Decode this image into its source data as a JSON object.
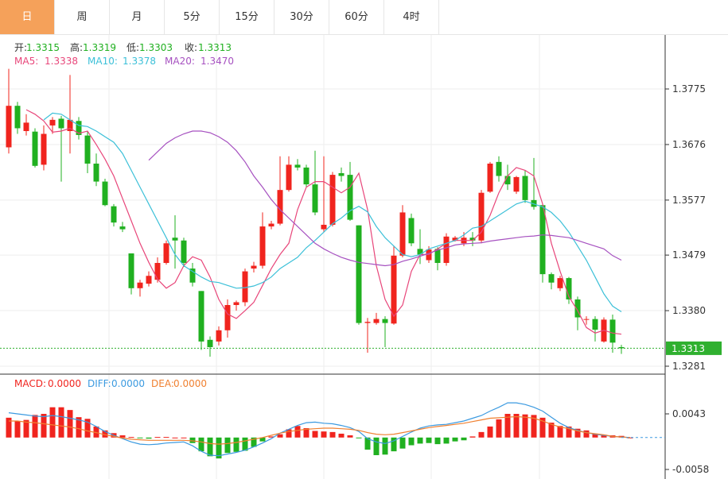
{
  "tabs": [
    {
      "label": "日",
      "active": true
    },
    {
      "label": "周",
      "active": false
    },
    {
      "label": "月",
      "active": false
    },
    {
      "label": "5分",
      "active": false
    },
    {
      "label": "15分",
      "active": false
    },
    {
      "label": "30分",
      "active": false
    },
    {
      "label": "60分",
      "active": false
    },
    {
      "label": "4时",
      "active": false
    }
  ],
  "ohlc_info": {
    "open_label": "开:",
    "open": "1.3315",
    "high_label": "高:",
    "high": "1.3319",
    "low_label": "低:",
    "low": "1.3303",
    "close_label": "收:",
    "close": "1.3313"
  },
  "ma_info": {
    "ma5_label": "MA5:",
    "ma5": "1.3338",
    "ma10_label": "MA10:",
    "ma10": "1.3378",
    "ma20_label": "MA20:",
    "ma20": "1.3470"
  },
  "macd_info": {
    "macd_label": "MACD:",
    "macd": "0.0000",
    "diff_label": "DIFF:",
    "diff": "0.0000",
    "dea_label": "DEA:",
    "dea": "0.0000"
  },
  "colors": {
    "up": "#f0241e",
    "down": "#20b020",
    "ma5": "#e8467a",
    "ma10": "#3cc0d8",
    "ma20": "#a651c0",
    "diff": "#3b9ae0",
    "dea": "#f08030",
    "current": "#2fb02f"
  },
  "chart_data": [
    {
      "type": "candlestick",
      "title": "",
      "y_ticks": [
        1.3775,
        1.3676,
        1.3577,
        1.3479,
        1.338,
        1.3281
      ],
      "y_tick_labels": [
        "1.3775",
        "1.3676",
        "1.3577",
        "1.3479",
        "1.3380",
        "1.3281"
      ],
      "ylim": [
        1.326,
        1.383
      ],
      "current_price": "1.3313",
      "candles": [
        [
          1.3671,
          1.3745,
          1.366,
          1.3811
        ],
        [
          1.3745,
          1.3705,
          1.3695,
          1.3752
        ],
        [
          1.37,
          1.3715,
          1.3692,
          1.373
        ],
        [
          1.3699,
          1.3638,
          1.3635,
          1.3705
        ],
        [
          1.364,
          1.3695,
          1.363,
          1.371
        ],
        [
          1.371,
          1.372,
          1.3695,
          1.3725
        ],
        [
          1.3722,
          1.3705,
          1.361,
          1.3727
        ],
        [
          1.37,
          1.372,
          1.366,
          1.38
        ],
        [
          1.3718,
          1.3693,
          1.3685,
          1.3725
        ],
        [
          1.3692,
          1.3642,
          1.3625,
          1.37
        ],
        [
          1.3642,
          1.361,
          1.3602,
          1.366
        ],
        [
          1.361,
          1.3568,
          1.3566,
          1.3615
        ],
        [
          1.3566,
          1.3537,
          1.353,
          1.357
        ],
        [
          1.353,
          1.3525,
          1.352,
          1.3538
        ],
        [
          1.3482,
          1.342,
          1.3409,
          1.3482
        ],
        [
          1.342,
          1.343,
          1.3405,
          1.3435
        ],
        [
          1.3428,
          1.3442,
          1.3423,
          1.345
        ],
        [
          1.3435,
          1.3465,
          1.343,
          1.3475
        ],
        [
          1.3465,
          1.35,
          1.3462,
          1.3505
        ],
        [
          1.351,
          1.3505,
          1.3455,
          1.355
        ],
        [
          1.3505,
          1.3465,
          1.3458,
          1.351
        ],
        [
          1.3455,
          1.343,
          1.3423,
          1.3465
        ],
        [
          1.3415,
          1.3325,
          1.331,
          1.3415
        ],
        [
          1.3328,
          1.3315,
          1.3298,
          1.3334
        ],
        [
          1.3325,
          1.3345,
          1.3318,
          1.3352
        ],
        [
          1.3345,
          1.339,
          1.3332,
          1.34
        ],
        [
          1.339,
          1.3395,
          1.338,
          1.3398
        ],
        [
          1.3395,
          1.345,
          1.3388,
          1.3455
        ],
        [
          1.3455,
          1.346,
          1.3448,
          1.3467
        ],
        [
          1.346,
          1.353,
          1.3455,
          1.3555
        ],
        [
          1.353,
          1.3535,
          1.3525,
          1.354
        ],
        [
          1.3535,
          1.3595,
          1.3532,
          1.3655
        ],
        [
          1.3595,
          1.364,
          1.3592,
          1.3655
        ],
        [
          1.364,
          1.3635,
          1.363,
          1.365
        ],
        [
          1.3635,
          1.3605,
          1.36,
          1.364
        ],
        [
          1.3605,
          1.3555,
          1.355,
          1.3665
        ],
        [
          1.3525,
          1.3533,
          1.352,
          1.3655
        ],
        [
          1.3533,
          1.3622,
          1.353,
          1.3627
        ],
        [
          1.3625,
          1.362,
          1.361,
          1.3635
        ],
        [
          1.3622,
          1.3542,
          1.354,
          1.3645
        ],
        [
          1.3532,
          1.3358,
          1.3355,
          1.3532
        ],
        [
          1.3358,
          1.336,
          1.3305,
          1.3367
        ],
        [
          1.3358,
          1.3365,
          1.3355,
          1.3376
        ],
        [
          1.3365,
          1.3358,
          1.3315,
          1.337
        ],
        [
          1.3357,
          1.3478,
          1.3355,
          1.3495
        ],
        [
          1.3478,
          1.3555,
          1.3475,
          1.3568
        ],
        [
          1.3545,
          1.35,
          1.3495,
          1.3553
        ],
        [
          1.349,
          1.348,
          1.3463,
          1.3525
        ],
        [
          1.347,
          1.3489,
          1.3465,
          1.3495
        ],
        [
          1.349,
          1.3465,
          1.3452,
          1.3493
        ],
        [
          1.3465,
          1.3512,
          1.346,
          1.3518
        ],
        [
          1.3505,
          1.351,
          1.3503,
          1.3513
        ],
        [
          1.35,
          1.351,
          1.3495,
          1.352
        ],
        [
          1.351,
          1.3505,
          1.3495,
          1.352
        ],
        [
          1.3505,
          1.359,
          1.35,
          1.3595
        ],
        [
          1.3592,
          1.3642,
          1.359,
          1.3645
        ],
        [
          1.3645,
          1.362,
          1.361,
          1.3655
        ],
        [
          1.362,
          1.3605,
          1.3595,
          1.364
        ],
        [
          1.3592,
          1.3618,
          1.3588,
          1.362
        ],
        [
          1.362,
          1.3577,
          1.3572,
          1.363
        ],
        [
          1.3577,
          1.3565,
          1.356,
          1.3652
        ],
        [
          1.3568,
          1.3445,
          1.343,
          1.357
        ],
        [
          1.3445,
          1.343,
          1.3418,
          1.3448
        ],
        [
          1.342,
          1.3438,
          1.3415,
          1.3442
        ],
        [
          1.3438,
          1.34,
          1.3392,
          1.344
        ],
        [
          1.34,
          1.3368,
          1.3345,
          1.3405
        ],
        [
          1.3365,
          1.3365,
          1.3355,
          1.337
        ],
        [
          1.3365,
          1.3346,
          1.3325,
          1.337
        ],
        [
          1.3325,
          1.3364,
          1.3323,
          1.3368
        ],
        [
          1.3364,
          1.3323,
          1.3305,
          1.3373
        ],
        [
          1.3315,
          1.3313,
          1.3303,
          1.3319
        ]
      ],
      "ma5": [
        1.3738,
        1.373,
        1.3718,
        1.3698,
        1.37,
        1.3705,
        1.3696,
        1.37,
        1.3676,
        1.365,
        1.362,
        1.358,
        1.354,
        1.35,
        1.3466,
        1.3436,
        1.342,
        1.343,
        1.346,
        1.3476,
        1.347,
        1.344,
        1.34,
        1.3374,
        1.3366,
        1.338,
        1.3395,
        1.3425,
        1.3455,
        1.348,
        1.35,
        1.356,
        1.36,
        1.361,
        1.361,
        1.36,
        1.359,
        1.36,
        1.3625,
        1.356,
        1.346,
        1.34,
        1.337,
        1.339,
        1.345,
        1.348,
        1.348,
        1.349,
        1.35,
        1.3505,
        1.3505,
        1.3505,
        1.352,
        1.355,
        1.359,
        1.362,
        1.3635,
        1.363,
        1.362,
        1.357,
        1.35,
        1.345,
        1.3405,
        1.338,
        1.335,
        1.334,
        1.3345,
        1.334,
        1.3338
      ],
      "ma10": [
        1.372,
        1.3732,
        1.373,
        1.372,
        1.371,
        1.3708,
        1.37,
        1.369,
        1.368,
        1.366,
        1.363,
        1.36,
        1.357,
        1.354,
        1.351,
        1.348,
        1.346,
        1.345,
        1.344,
        1.3432,
        1.343,
        1.3425,
        1.342,
        1.3421,
        1.3424,
        1.343,
        1.344,
        1.3455,
        1.3465,
        1.3475,
        1.3492,
        1.3505,
        1.352,
        1.3535,
        1.3545,
        1.3558,
        1.3566,
        1.3556,
        1.353,
        1.351,
        1.3495,
        1.348,
        1.3476,
        1.348,
        1.349,
        1.3495,
        1.35,
        1.3505,
        1.3515,
        1.3527,
        1.353,
        1.354,
        1.355,
        1.356,
        1.357,
        1.3575,
        1.357,
        1.3565,
        1.3555,
        1.354,
        1.352,
        1.3495,
        1.347,
        1.344,
        1.341,
        1.3388,
        1.3378
      ],
      "ma20": [
        1.3648,
        1.3663,
        1.3678,
        1.3688,
        1.3695,
        1.37,
        1.37,
        1.3697,
        1.369,
        1.368,
        1.3665,
        1.3645,
        1.362,
        1.36,
        1.3578,
        1.356,
        1.3545,
        1.353,
        1.3515,
        1.35,
        1.349,
        1.3482,
        1.3475,
        1.347,
        1.3466,
        1.3464,
        1.3462,
        1.346,
        1.3462,
        1.3468,
        1.3472,
        1.3477,
        1.3482,
        1.3488,
        1.3492,
        1.3497,
        1.3499,
        1.35,
        1.3501,
        1.3504,
        1.3506,
        1.3508,
        1.351,
        1.3512,
        1.3513,
        1.3515,
        1.3514,
        1.3512,
        1.351,
        1.3505,
        1.35,
        1.3495,
        1.349,
        1.3478,
        1.347
      ],
      "ma20_start": 16
    },
    {
      "type": "bar",
      "title": "MACD",
      "y_ticks": [
        0.0043,
        -0.0058
      ],
      "y_tick_labels": [
        "0.0043",
        "-0.0058"
      ],
      "ylim": [
        -0.0065,
        0.007
      ],
      "macd": [
        0.0036,
        0.003,
        0.0032,
        0.0041,
        0.0043,
        0.0055,
        0.0055,
        0.005,
        0.0037,
        0.0034,
        0.002,
        0.0013,
        0.0008,
        0.0004,
        0.0001,
        -0.0001,
        -0.0002,
        0.0001,
        0.0001,
        0.0,
        0.0,
        -0.001,
        -0.0025,
        -0.0034,
        -0.0038,
        -0.0028,
        -0.0026,
        -0.0024,
        -0.0017,
        -0.0007,
        0.0002,
        0.0006,
        0.0015,
        0.0021,
        0.0017,
        0.0012,
        0.0011,
        0.001,
        0.0007,
        0.0004,
        -0.0001,
        -0.0022,
        -0.0032,
        -0.0031,
        -0.0025,
        -0.002,
        -0.0014,
        -0.0011,
        -0.001,
        -0.0012,
        -0.0011,
        -0.0007,
        -0.0005,
        0.0002,
        0.001,
        0.002,
        0.0033,
        0.0043,
        0.0043,
        0.0042,
        0.0041,
        0.0036,
        0.0027,
        0.0021,
        0.002,
        0.0016,
        0.0013,
        0.0007,
        0.0005,
        0.0004,
        0.0003,
        0.0
      ],
      "diff": [
        0.0045,
        0.0043,
        0.0041,
        0.0039,
        0.0038,
        0.004,
        0.0038,
        0.0035,
        0.0032,
        0.0028,
        0.002,
        0.0011,
        0.0004,
        -0.0002,
        -0.0008,
        -0.0012,
        -0.0013,
        -0.0012,
        -0.001,
        -0.0009,
        -0.0008,
        -0.0015,
        -0.0025,
        -0.0032,
        -0.0033,
        -0.003,
        -0.0027,
        -0.0023,
        -0.0017,
        -0.001,
        -0.0002,
        0.0008,
        0.0015,
        0.0022,
        0.0027,
        0.0028,
        0.0026,
        0.0025,
        0.0022,
        0.0018,
        0.0011,
        -0.0002,
        -0.0008,
        -0.0011,
        -0.0006,
        0.0002,
        0.001,
        0.0017,
        0.0021,
        0.0023,
        0.0024,
        0.0027,
        0.003,
        0.0035,
        0.004,
        0.0048,
        0.0055,
        0.0063,
        0.0063,
        0.006,
        0.0055,
        0.0048,
        0.0037,
        0.0026,
        0.0018,
        0.0013,
        0.0009,
        0.0006,
        0.0004,
        0.0002,
        0.0001,
        0.0
      ],
      "dea": [
        0.003,
        0.003,
        0.0028,
        0.0027,
        0.0025,
        0.0023,
        0.0021,
        0.0019,
        0.0016,
        0.0012,
        0.0009,
        0.0005,
        0.0002,
        -0.0001,
        -0.0003,
        -0.0004,
        -0.0005,
        -0.0005,
        -0.0005,
        -0.0005,
        -0.0005,
        -0.0006,
        -0.0008,
        -0.0011,
        -0.0012,
        -0.0011,
        -0.0009,
        -0.0006,
        -0.0003,
        0.0,
        0.0004,
        0.0008,
        0.0011,
        0.0013,
        0.0015,
        0.0016,
        0.0017,
        0.0017,
        0.0016,
        0.0015,
        0.0013,
        0.0009,
        0.0006,
        0.0005,
        0.0006,
        0.0009,
        0.0012,
        0.0015,
        0.0018,
        0.002,
        0.0022,
        0.0024,
        0.0026,
        0.0029,
        0.0032,
        0.0035,
        0.0036,
        0.0037,
        0.0038,
        0.0037,
        0.0035,
        0.003,
        0.0024,
        0.0019,
        0.0016,
        0.0012,
        0.0009,
        0.0007,
        0.0005,
        0.0002,
        0.0001,
        0.0
      ]
    }
  ]
}
